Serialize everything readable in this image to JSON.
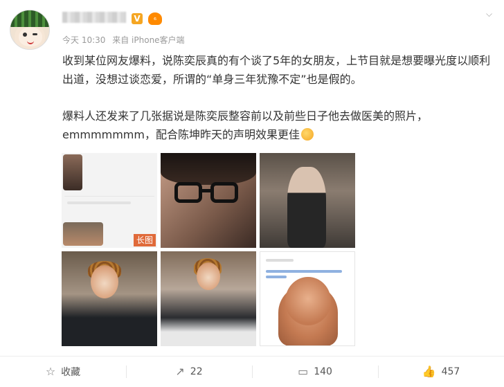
{
  "post": {
    "author_badge_v": "V",
    "author_level": "₆",
    "meta_time": "今天 10:30",
    "meta_source": "来自 iPhone客户端",
    "paragraph1": "收到某位网友爆料，说陈奕辰真的有个谈了5年的女朋友，上节目就是想要曝光度以顺利出道，没想过谈恋爱，所谓的“单身三年犹豫不定”也是假的。",
    "paragraph2": "爆料人还发来了几张据说是陈奕辰整容前以及前些日子他去做医美的照片，emmmmmmm，配合陈坤昨天的声明效果更佳",
    "long_image_tag": "长图",
    "menu_caret": "⌵"
  },
  "actions": {
    "favorite": {
      "icon": "star-icon",
      "label": "收藏"
    },
    "repost": {
      "icon": "share-icon",
      "label": "22"
    },
    "comment": {
      "icon": "comment-icon",
      "label": "140"
    },
    "like": {
      "icon": "thumbs-up-icon",
      "label": "457"
    }
  }
}
